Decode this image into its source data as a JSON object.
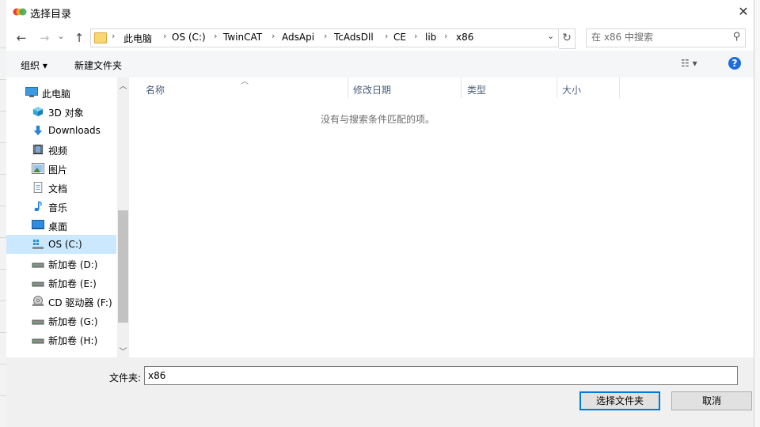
{
  "window": {
    "title": "选择目录",
    "close_icon": "✕"
  },
  "nav_buttons": {
    "back": "←",
    "forward": "→",
    "recent": "⌄",
    "up": "↑"
  },
  "address": {
    "crumbs": [
      "此电脑",
      "OS (C:)",
      "TwinCAT",
      "AdsApi",
      "TcAdsDll",
      "CE",
      "lib",
      "x86"
    ],
    "separator": "›",
    "dropdown": "⌄",
    "refresh": "↻"
  },
  "search": {
    "placeholder": "在 x86 中搜索",
    "icon": "⚲"
  },
  "toolbar": {
    "organize": "组织 ▾",
    "new_folder": "新建文件夹",
    "view_icon": "☷ ▾",
    "help": "?"
  },
  "nav_pane": {
    "items": [
      {
        "label": "此电脑",
        "icon": "computer-icon"
      },
      {
        "label": "3D 对象",
        "icon": "cube-icon"
      },
      {
        "label": "Downloads",
        "icon": "download-icon"
      },
      {
        "label": "视频",
        "icon": "video-icon"
      },
      {
        "label": "图片",
        "icon": "picture-icon"
      },
      {
        "label": "文档",
        "icon": "document-icon"
      },
      {
        "label": "音乐",
        "icon": "music-icon"
      },
      {
        "label": "桌面",
        "icon": "desktop-icon"
      },
      {
        "label": "OS (C:)",
        "icon": "windows-drive-icon",
        "selected": true
      },
      {
        "label": "新加卷 (D:)",
        "icon": "drive-icon"
      },
      {
        "label": "新加卷 (E:)",
        "icon": "drive-icon"
      },
      {
        "label": "CD 驱动器 (F:)",
        "icon": "cd-drive-icon"
      },
      {
        "label": "新加卷 (G:)",
        "icon": "drive-icon"
      },
      {
        "label": "新加卷 (H:)",
        "icon": "drive-icon"
      }
    ],
    "scroll_up": "︿",
    "scroll_down": "﹀"
  },
  "file_list": {
    "columns": [
      "名称",
      "修改日期",
      "类型",
      "大小"
    ],
    "sort_arrow": "︿",
    "empty_message": "没有与搜索条件匹配的项。"
  },
  "bottom": {
    "folder_label": "文件夹:",
    "folder_value": "x86",
    "select_button": "选择文件夹",
    "cancel_button": "取消"
  },
  "colors": {
    "accent": "#0078d7",
    "selected_bg": "#cce8ff",
    "help_blue": "#1e6fd9",
    "folder_yellow": "#f8d775"
  }
}
